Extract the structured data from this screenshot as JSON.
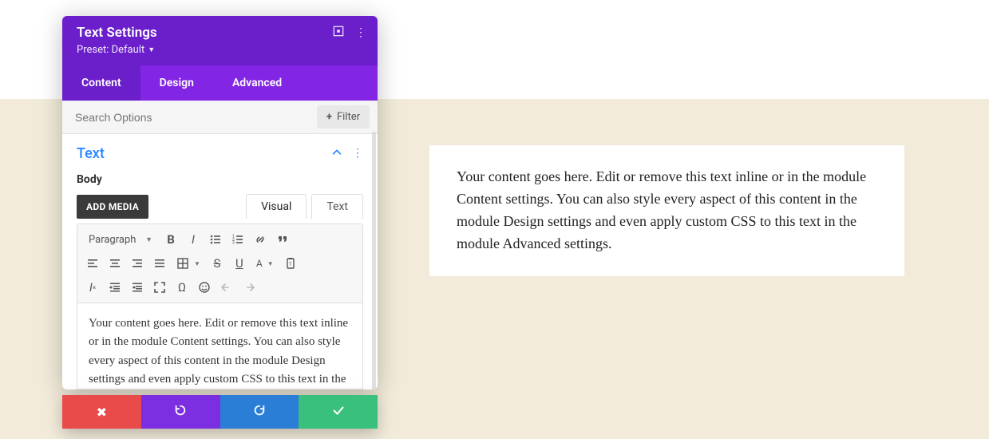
{
  "header": {
    "title": "Text Settings",
    "preset_prefix": "Preset: ",
    "preset_value": "Default"
  },
  "tabs": {
    "content": "Content",
    "design": "Design",
    "advanced": "Advanced"
  },
  "search": {
    "placeholder": "Search Options",
    "filter_label": "Filter"
  },
  "section": {
    "title": "Text"
  },
  "body_label": "Body",
  "editor": {
    "add_media": "ADD MEDIA",
    "mode_visual": "Visual",
    "mode_text": "Text",
    "paragraph_label": "Paragraph",
    "content": "Your content goes here. Edit or remove this text inline or in the module Content settings. You can also style every aspect of this content in the module Design settings and even apply custom CSS to this text in the module Advanced settings.",
    "font_letter": "A",
    "omega": "Ω"
  },
  "preview": {
    "text": "Your content goes here. Edit or remove this text inline or in the module Content settings. You can also style every aspect of this content in the module Design settings and even apply custom CSS to this text in the module Advanced settings."
  }
}
